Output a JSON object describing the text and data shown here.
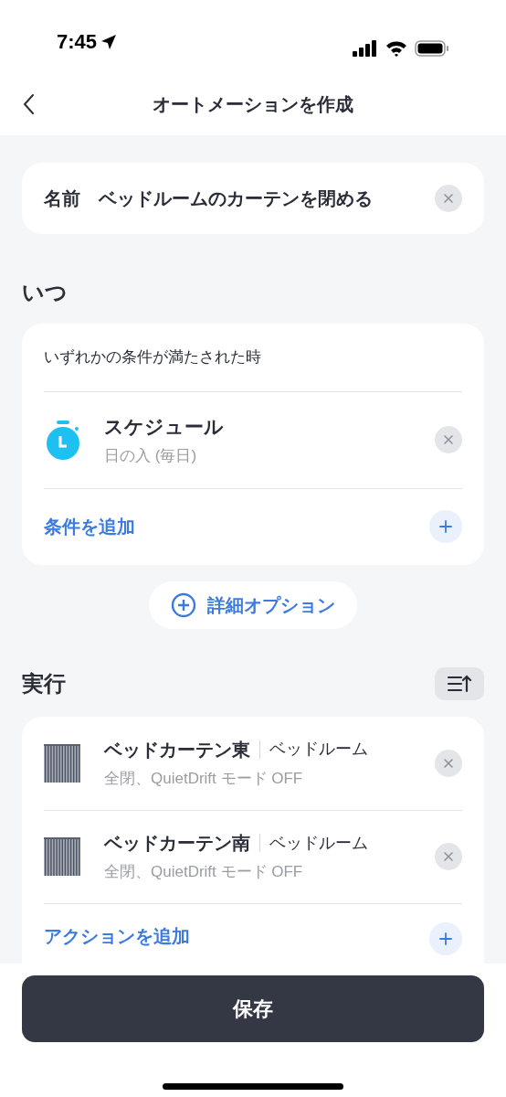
{
  "status_bar": {
    "time": "7:45"
  },
  "header": {
    "title": "オートメーションを作成"
  },
  "name_field": {
    "label": "名前",
    "value": "ベッドルームのカーテンを閉める"
  },
  "when": {
    "heading": "いつ",
    "condition_mode": "いずれかの条件が満たされた時",
    "conditions": [
      {
        "kind": "schedule",
        "title": "スケジュール",
        "subtitle": "日の入 (毎日)"
      }
    ],
    "add_label": "条件を追加"
  },
  "advanced_button": "詳細オプション",
  "execute": {
    "heading": "実行",
    "actions": [
      {
        "kind": "curtain",
        "title": "ベッドカーテン東",
        "room": "ベッドルーム",
        "subtitle": "全閉、QuietDrift モード OFF"
      },
      {
        "kind": "curtain",
        "title": "ベッドカーテン南",
        "room": "ベッドルーム",
        "subtitle": "全閉、QuietDrift モード OFF"
      }
    ],
    "add_label": "アクションを追加"
  },
  "save_button": "保存"
}
